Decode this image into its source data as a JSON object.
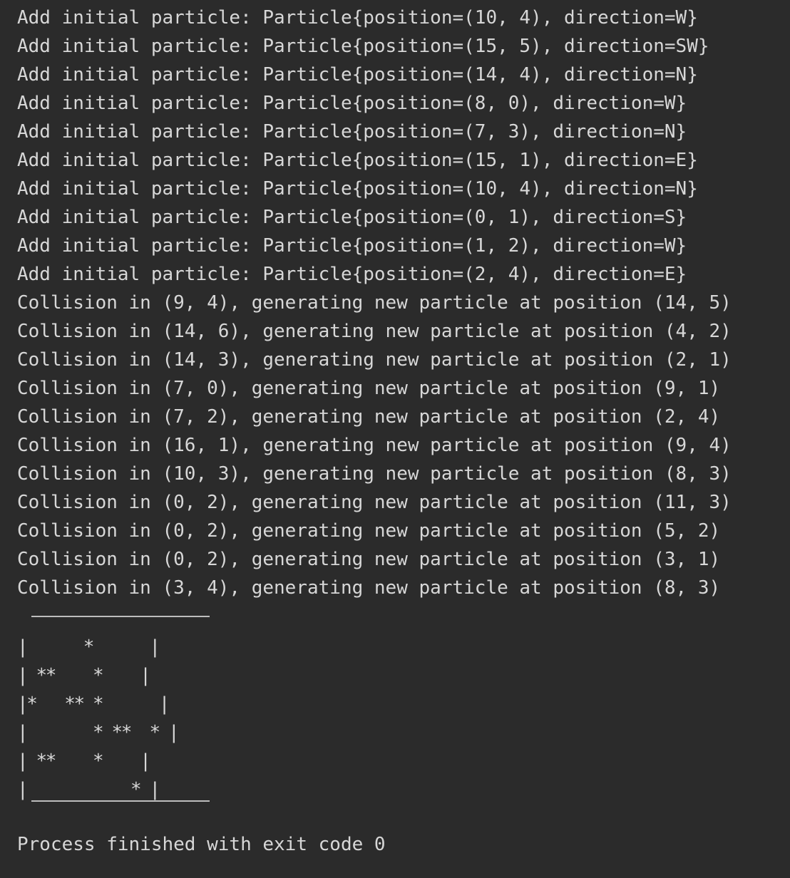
{
  "console": {
    "lines": [
      "Add initial particle: Particle{position=(10, 4), direction=W}",
      "Add initial particle: Particle{position=(15, 5), direction=SW}",
      "Add initial particle: Particle{position=(14, 4), direction=N}",
      "Add initial particle: Particle{position=(8, 0), direction=W}",
      "Add initial particle: Particle{position=(7, 3), direction=N}",
      "Add initial particle: Particle{position=(15, 1), direction=E}",
      "Add initial particle: Particle{position=(10, 4), direction=N}",
      "Add initial particle: Particle{position=(0, 1), direction=S}",
      "Add initial particle: Particle{position=(1, 2), direction=W}",
      "Add initial particle: Particle{position=(2, 4), direction=E}",
      "Collision in (9, 4), generating new particle at position (14, 5)",
      "Collision in (14, 6), generating new particle at position (4, 2)",
      "Collision in (14, 3), generating new particle at position (2, 1)",
      "Collision in (7, 0), generating new particle at position (9, 1)",
      "Collision in (7, 2), generating new particle at position (2, 4)",
      "Collision in (16, 1), generating new particle at position (9, 4)",
      "Collision in (10, 3), generating new particle at position (8, 3)",
      "Collision in (0, 2), generating new particle at position (11, 3)",
      "Collision in (0, 2), generating new particle at position (5, 2)",
      "Collision in (0, 2), generating new particle at position (3, 1)",
      "Collision in (3, 4), generating new particle at position (8, 3)"
    ],
    "grid_rows": [
      "|      *      |",
      "| **    *    |",
      "|*   ** *      |",
      "|       * **  * |",
      "| **    *    |",
      "|           * |"
    ],
    "exit_message": "Process finished with exit code 0"
  }
}
